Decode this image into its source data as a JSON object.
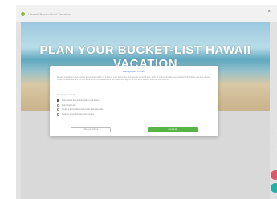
{
  "header": {
    "brand_text": "Hawaii Bucket List Vacation",
    "close_glyph": "×"
  },
  "hero": {
    "title": "PLAN YOUR BUCKET-LIST HAWAII VACATION"
  },
  "side": {
    "text_a": "...",
    "text_b": "..."
  },
  "modal": {
    "title": "Manage your Privacy",
    "body": "We and our partners store and/or access information on a device, such as cookies, and process personal data, such as unique identifiers and standard information sent by a device for personalised ads and content, ad and content measurement, and audience insights, as well as to develop and improve products.",
    "subtitle": "Manage your settings",
    "options": [
      {
        "label": "Store and/or access information on a device",
        "checked": true
      },
      {
        "label": "Select basic ads",
        "checked": false
      },
      {
        "label": "Create a personalised ads profile and select ads",
        "checked": false
      },
      {
        "label": "Measure ad performance and content",
        "checked": false
      }
    ],
    "buttons": {
      "secondary": "Manage options",
      "primary": "Accept all"
    }
  },
  "colors": {
    "accent_green": "#56b545",
    "title_blue": "#4a7fd0",
    "fab_pink": "#e0566f",
    "fab_teal": "#1fb3a6"
  }
}
